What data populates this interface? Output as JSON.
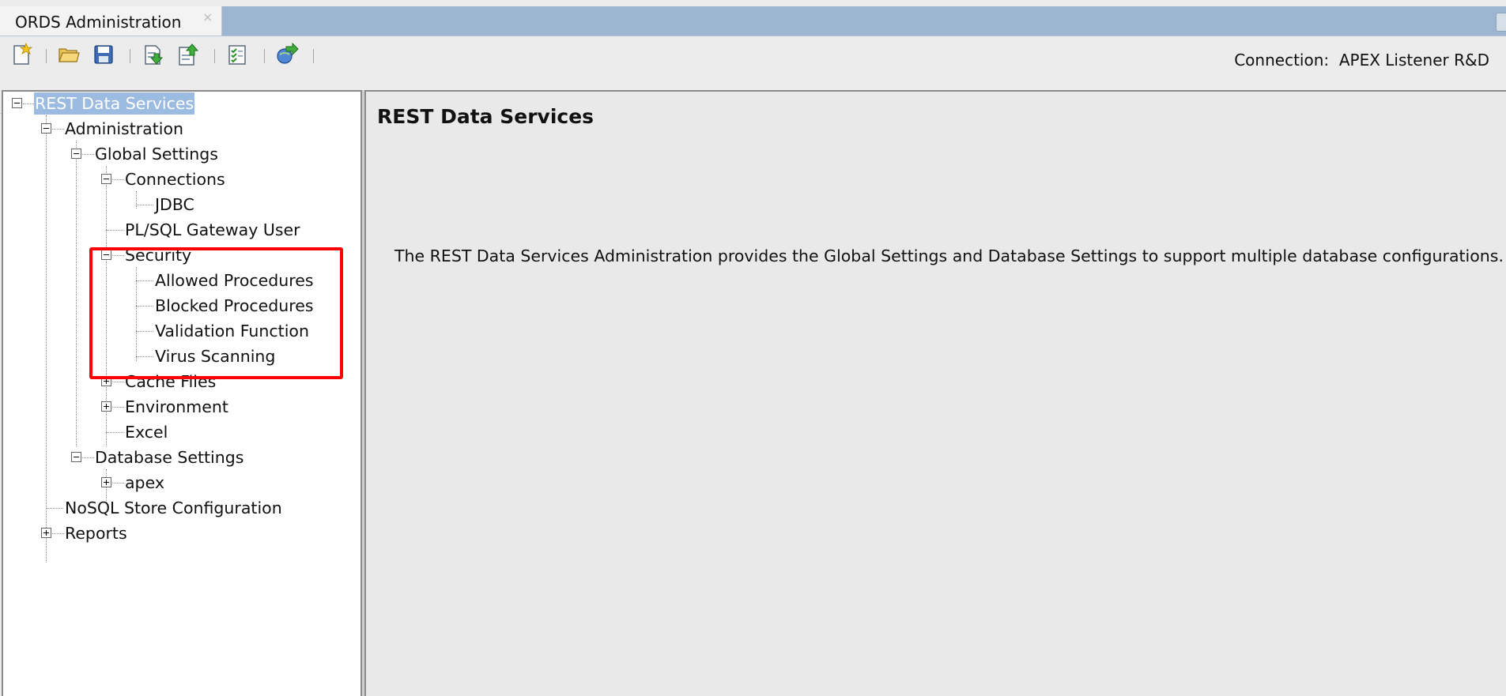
{
  "tab": {
    "title": "ORDS Administration",
    "close_glyph": "×"
  },
  "toolbar": {
    "buttons": [
      {
        "name": "new-icon"
      },
      {
        "name": "open-folder-icon"
      },
      {
        "name": "save-icon"
      },
      {
        "name": "retrieve-settings-icon"
      },
      {
        "name": "upload-settings-icon"
      },
      {
        "name": "validate-settings-icon"
      },
      {
        "name": "connect-icon"
      }
    ],
    "connection_label": "Connection:",
    "connection_value": "APEX Listener R&D"
  },
  "tree": {
    "root": "REST Data Services",
    "administration": "Administration",
    "global_settings": "Global Settings",
    "connections": "Connections",
    "jdbc": "JDBC",
    "plsql_gateway_user": "PL/SQL Gateway User",
    "security": "Security",
    "allowed_procedures": "Allowed Procedures",
    "blocked_procedures": "Blocked Procedures",
    "validation_function": "Validation Function",
    "virus_scanning": "Virus Scanning",
    "cache_files": "Cache Files",
    "environment": "Environment",
    "excel": "Excel",
    "database_settings": "Database Settings",
    "apex": "apex",
    "nosql_store_configuration": "NoSQL Store Configuration",
    "reports": "Reports"
  },
  "content": {
    "title": "REST Data Services",
    "description": "The REST Data Services Administration provides the Global Settings and Database Settings to support multiple database configurations."
  },
  "colors": {
    "selection": "#9cbbe0",
    "tab_bar": "#9cb6d2",
    "highlight": "#ff0000"
  }
}
